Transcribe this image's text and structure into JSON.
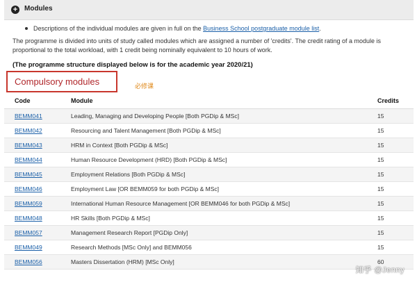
{
  "section": {
    "title": "Modules"
  },
  "intro": {
    "bullet_prefix": "Descriptions of the individual modules are given in full on the ",
    "bullet_link": "Business School postgraduate module list",
    "bullet_suffix": ".",
    "paragraph": "The programme is divided into units of study called modules which are assigned a number of 'credits'. The credit rating of a module is proportional to the total workload, with 1 credit being nominally equivalent to 10 hours of work.",
    "year_note": "(The programme structure displayed below is for the academic year 2020/21)"
  },
  "compulsory": {
    "title": "Compulsory modules",
    "annotation": "必修课"
  },
  "table": {
    "headers": [
      "Code",
      "Module",
      "Credits"
    ],
    "rows": [
      {
        "code": "BEMM041",
        "module": "Leading, Managing and Developing People [Both PGDip & MSc]",
        "credits": "15"
      },
      {
        "code": "BEMM042",
        "module": "Resourcing and Talent Management [Both PGDip & MSc]",
        "credits": "15"
      },
      {
        "code": "BEMM043",
        "module": "HRM in Context [Both PGDip & MSc]",
        "credits": "15"
      },
      {
        "code": "BEMM044",
        "module": "Human Resource Development (HRD) [Both PGDip & MSc]",
        "credits": "15"
      },
      {
        "code": "BEMM045",
        "module": "Employment Relations [Both PGDip & MSc]",
        "credits": "15"
      },
      {
        "code": "BEMM046",
        "module": "Employment Law [OR BEMM059 for both PGDip & MSc]",
        "credits": "15"
      },
      {
        "code": "BEMM059",
        "module": "International Human Resource Management [OR BEMM046 for both PGDip & MSc]",
        "credits": "15"
      },
      {
        "code": "BEMM048",
        "module": "HR Skills [Both PGDip & MSc]",
        "credits": "15"
      },
      {
        "code": "BEMM057",
        "module": "Management Research Report [PGDip Only]",
        "credits": "15"
      },
      {
        "code": "BEMM049",
        "module": "Research Methods [MSc Only] and BEMM056",
        "credits": "15"
      },
      {
        "code": "BEMM056",
        "module": "Masters Dissertation (HRM) [MSc Only]",
        "credits": "60"
      }
    ]
  },
  "watermark": "知乎 @Jenny"
}
